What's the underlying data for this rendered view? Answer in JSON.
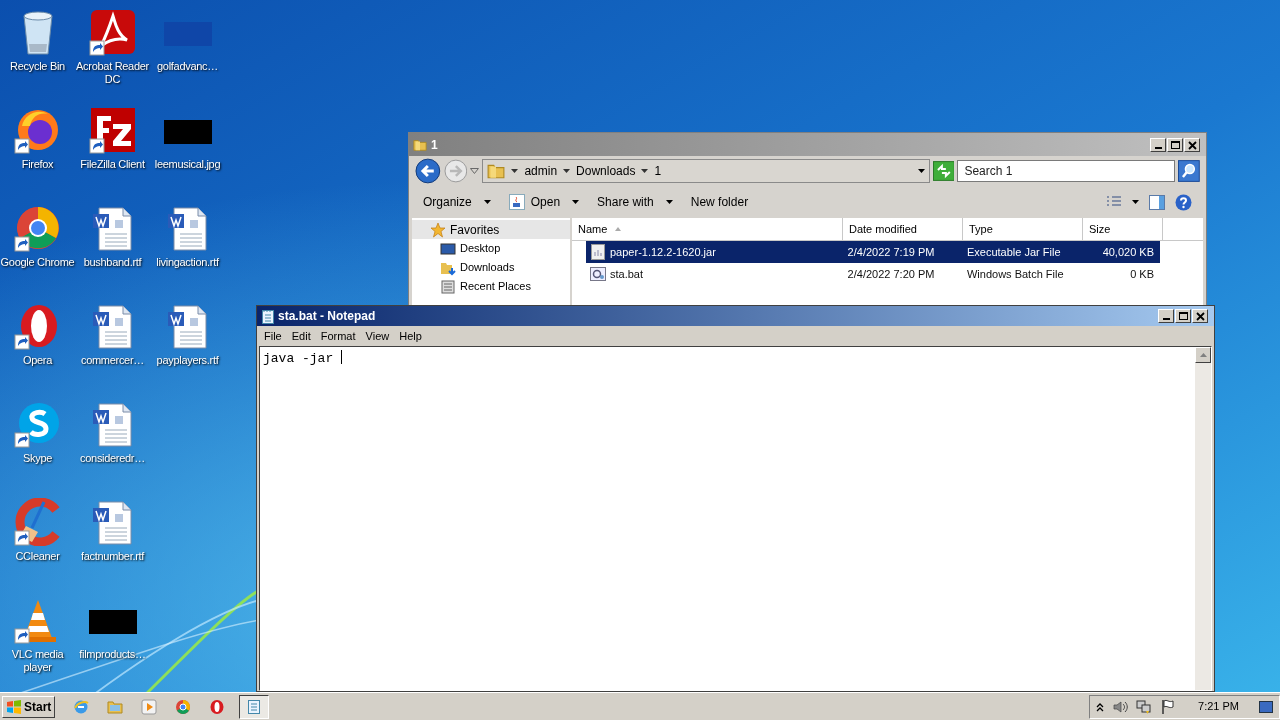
{
  "desktop_icons": [
    {
      "label": "Recycle Bin",
      "kind": "recycle-bin",
      "shortcut": false
    },
    {
      "label": "Firefox",
      "kind": "firefox",
      "shortcut": true
    },
    {
      "label": "Google Chrome",
      "kind": "chrome",
      "shortcut": true
    },
    {
      "label": "Opera",
      "kind": "opera",
      "shortcut": true
    },
    {
      "label": "Skype",
      "kind": "skype",
      "shortcut": true
    },
    {
      "label": "CCleaner",
      "kind": "ccleaner",
      "shortcut": true
    },
    {
      "label": "VLC media player",
      "kind": "vlc",
      "shortcut": true
    },
    {
      "label": "Acrobat Reader DC",
      "kind": "acrobat",
      "shortcut": true
    },
    {
      "label": "FileZilla Client",
      "kind": "filezilla",
      "shortcut": true
    },
    {
      "label": "bushband.rtf",
      "kind": "word-doc",
      "shortcut": false
    },
    {
      "label": "commercer…",
      "kind": "word-doc",
      "shortcut": false
    },
    {
      "label": "consideredr…",
      "kind": "word-doc",
      "shortcut": false
    },
    {
      "label": "factnumber.rtf",
      "kind": "word-doc",
      "shortcut": false
    },
    {
      "label": "filmproducts…",
      "kind": "black-image",
      "shortcut": false
    },
    {
      "label": "golfadvanc…",
      "kind": "blue-image",
      "shortcut": false
    },
    {
      "label": "leemusical.jpg",
      "kind": "black-image",
      "shortcut": false
    },
    {
      "label": "livingaction.rtf",
      "kind": "word-doc",
      "shortcut": false
    },
    {
      "label": "payplayers.rtf",
      "kind": "word-doc",
      "shortcut": false
    }
  ],
  "explorer": {
    "title": "1",
    "breadcrumb": [
      "admin",
      "Downloads",
      "1"
    ],
    "search": {
      "placeholder": "Search 1"
    },
    "toolbar": [
      {
        "label": "Organize",
        "kind": "plain",
        "dropdown": true
      },
      {
        "label": "Open",
        "kind": "open",
        "dropdown": true
      },
      {
        "label": "Share with",
        "kind": "plain",
        "dropdown": true
      },
      {
        "label": "New folder",
        "kind": "plain",
        "dropdown": false
      }
    ],
    "nav": [
      {
        "label": "Favorites",
        "kind": "favorites",
        "selected": true
      },
      {
        "label": "Desktop",
        "kind": "desktop",
        "selected": false
      },
      {
        "label": "Downloads",
        "kind": "downloads",
        "selected": false
      },
      {
        "label": "Recent Places",
        "kind": "recent",
        "selected": false
      }
    ],
    "columns": [
      "Name",
      "Date modified",
      "Type",
      "Size"
    ],
    "rows": [
      {
        "name": "paper-1.12.2-1620.jar",
        "date": "2/4/2022 7:19 PM",
        "type": "Executable Jar File",
        "size": "40,020 KB",
        "kind": "jar",
        "selected": true
      },
      {
        "name": "sta.bat",
        "date": "2/4/2022 7:20 PM",
        "type": "Windows Batch File",
        "size": "0 KB",
        "kind": "bat",
        "selected": false
      }
    ]
  },
  "notepad": {
    "title": "sta.bat - Notepad",
    "menu": [
      "File",
      "Edit",
      "Format",
      "View",
      "Help"
    ],
    "text": "java -jar "
  },
  "taskbar": {
    "start": "Start",
    "apps": [
      {
        "kind": "ie",
        "active": false
      },
      {
        "kind": "explorer",
        "active": false
      },
      {
        "kind": "media",
        "active": false
      },
      {
        "kind": "chrome",
        "active": false
      },
      {
        "kind": "opera",
        "active": false
      },
      {
        "kind": "notepad",
        "active": true
      }
    ],
    "clock": "7:21 PM"
  }
}
